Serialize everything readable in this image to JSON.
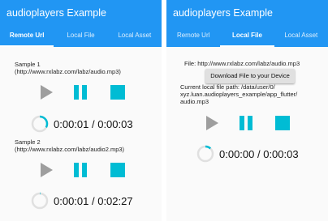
{
  "screens": [
    {
      "title": "audioplayers Example",
      "tabs": [
        "Remote Url",
        "Local File",
        "Local Asset"
      ],
      "active_tab": 0,
      "samples": [
        {
          "label_line1": "Sample 1",
          "label_line2": "(http://www.rxlabz.com/labz/audio.mp3)",
          "time": "0:00:01 / 0:00:03",
          "progress": 0.33
        },
        {
          "label_line1": "Sample 2",
          "label_line2": "(http://www.rxlabz.com/labz/audio2.mp3)",
          "time": "0:00:01 / 0:02:27",
          "progress": 0.01
        }
      ]
    },
    {
      "title": "audioplayers Example",
      "tabs": [
        "Remote Url",
        "Local File",
        "Local Asset"
      ],
      "active_tab": 1,
      "file_text": "File: http://www.rxlabz.com/labz/audio.mp3",
      "download_label": "Download File to your Device",
      "local_path_line1": "Current local file path: /data/user/0/",
      "local_path_line2": "xyz.luan.audioplayers_example/app_flutter/",
      "local_path_line3": "audio.mp3",
      "time": "0:00:00 / 0:00:03",
      "progress": 0.12
    }
  ],
  "colors": {
    "appbar": "#2196f3",
    "accent": "#00bcd4",
    "disabled": "#9e9e9e",
    "track": "#e0e0e0"
  }
}
